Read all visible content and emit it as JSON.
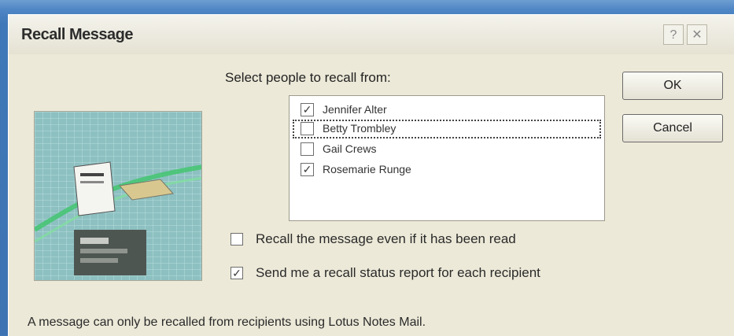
{
  "dialog": {
    "title": "Recall Message",
    "help_label": "?",
    "close_label": "✕"
  },
  "recipients": {
    "label": "Select people to recall from:",
    "items": [
      {
        "name": "Jennifer Alter",
        "checked": "✓"
      },
      {
        "name": "Betty Trombley",
        "checked": ""
      },
      {
        "name": "Gail Crews",
        "checked": ""
      },
      {
        "name": "Rosemarie Runge",
        "checked": "✓"
      }
    ]
  },
  "buttons": {
    "ok": "OK",
    "cancel": "Cancel"
  },
  "options": {
    "recall_read": {
      "label": "Recall the message even if it has been read",
      "checked": ""
    },
    "send_report": {
      "label": "Send me a recall status report for each recipient",
      "checked": "✓"
    }
  },
  "footer_text": "A message can only be recalled from recipients using Lotus Notes Mail.",
  "colors": {
    "dialog_bg": "#ece9d8",
    "window_frame": "#3f78b8"
  }
}
